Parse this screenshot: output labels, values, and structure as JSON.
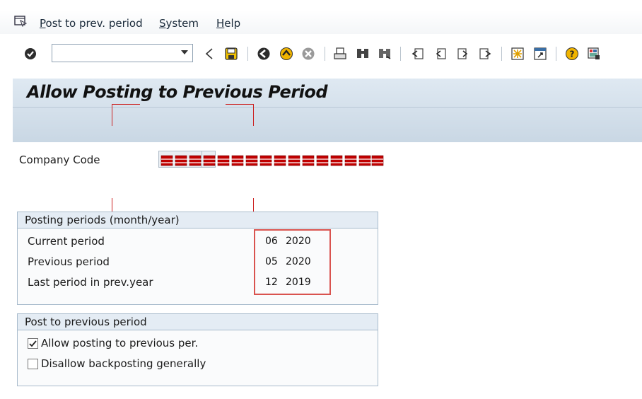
{
  "menu": {
    "items": [
      {
        "label_ul": "P",
        "label_rest": "ost to prev. period"
      },
      {
        "label_ul": "S",
        "label_rest": "ystem"
      },
      {
        "label_ul": "H",
        "label_rest": "elp"
      }
    ]
  },
  "toolbar": {
    "command_value": "",
    "icons": [
      "enter-icon",
      "back-arrow-icon",
      "save-icon",
      "back-icon",
      "exit-icon",
      "cancel-icon",
      "print-icon",
      "find-icon",
      "find-next-icon",
      "first-page-icon",
      "previous-page-icon",
      "next-page-icon",
      "last-page-icon",
      "create-session-icon",
      "shortcut-icon",
      "help-icon",
      "customize-layout-icon"
    ]
  },
  "page": {
    "title": "Allow Posting to Previous Period"
  },
  "company": {
    "label": "Company Code"
  },
  "posting_periods": {
    "title": "Posting periods (month/year)",
    "rows": [
      {
        "label": "Current period",
        "month": "06",
        "year": "2020"
      },
      {
        "label": "Previous period",
        "month": "05",
        "year": "2020"
      },
      {
        "label": "Last period in prev.year",
        "month": "12",
        "year": "2019"
      }
    ]
  },
  "post_prev": {
    "title": "Post to previous period",
    "options": [
      {
        "label": "Allow posting to previous per.",
        "checked": true
      },
      {
        "label": "Disallow backposting generally",
        "checked": false
      }
    ]
  },
  "colors": {
    "annotation_red": "#cc2222",
    "highlight_red": "#d9534f",
    "title_panel": "#d3dfea"
  }
}
